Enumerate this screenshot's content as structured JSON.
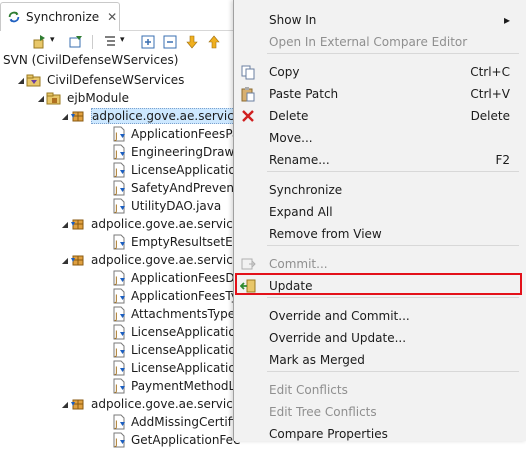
{
  "view": {
    "tab_title": "Synchronize",
    "tab_close": "✕",
    "header": "SVN (CivilDefenseWServices)",
    "tree": [
      {
        "label": "CivilDefenseWServices",
        "indent": 1,
        "twisty": "◢",
        "icon": "project-icon"
      },
      {
        "label": "ejbModule",
        "indent": 2,
        "twisty": "◢",
        "icon": "source-folder-icon"
      },
      {
        "label": "adpolice.gove.ae.servic",
        "indent": 3,
        "twisty": "◢",
        "icon": "package-icon",
        "selected": true
      },
      {
        "label": "ApplicationFeesPa",
        "indent": 4,
        "icon": "java-file-icon"
      },
      {
        "label": "EngineeringDrawi",
        "indent": 4,
        "icon": "java-file-icon"
      },
      {
        "label": "LicenseApplicatio",
        "indent": 4,
        "icon": "java-file-icon"
      },
      {
        "label": "SafetyAndPrevent",
        "indent": 4,
        "icon": "java-file-icon"
      },
      {
        "label": "UtilityDAO.java",
        "indent": 4,
        "icon": "java-file-icon"
      },
      {
        "label": "adpolice.gove.ae.servic",
        "indent": 3,
        "twisty": "◢",
        "icon": "package-icon"
      },
      {
        "label": "EmptyResultsetExc",
        "indent": 4,
        "icon": "java-file-icon"
      },
      {
        "label": "adpolice.gove.ae.servic",
        "indent": 3,
        "twisty": "◢",
        "icon": "package-icon"
      },
      {
        "label": "ApplicationFeesDa",
        "indent": 4,
        "icon": "java-file-icon"
      },
      {
        "label": "ApplicationFeesTy",
        "indent": 4,
        "icon": "java-file-icon"
      },
      {
        "label": "AttachmentsType",
        "indent": 4,
        "icon": "java-file-icon"
      },
      {
        "label": "LicenseApplicatio",
        "indent": 4,
        "icon": "java-file-icon"
      },
      {
        "label": "LicenseApplicatio",
        "indent": 4,
        "icon": "java-file-icon"
      },
      {
        "label": "LicenseApplicatio",
        "indent": 4,
        "icon": "java-file-icon"
      },
      {
        "label": "PaymentMethodL",
        "indent": 4,
        "icon": "java-file-icon"
      },
      {
        "label": "adpolice.gove.ae.servic",
        "indent": 3,
        "twisty": "◢",
        "icon": "package-icon"
      },
      {
        "label": "AddMissingCertifi",
        "indent": 4,
        "icon": "java-file-icon"
      },
      {
        "label": "GetApplicationFee",
        "indent": 4,
        "icon": "java-file-icon"
      }
    ]
  },
  "menu": {
    "items": [
      {
        "label": "Show In",
        "shortcut": "▸",
        "enabled": true
      },
      {
        "label": "Open In External Compare Editor",
        "shortcut": "",
        "enabled": false
      },
      {
        "label": "Copy",
        "shortcut": "Ctrl+C",
        "enabled": true,
        "icon": "copy-icon"
      },
      {
        "label": "Paste Patch",
        "shortcut": "Ctrl+V",
        "enabled": true,
        "icon": "paste-icon"
      },
      {
        "label": "Delete",
        "shortcut": "Delete",
        "enabled": true,
        "icon": "delete-icon"
      },
      {
        "label": "Move...",
        "shortcut": "",
        "enabled": true
      },
      {
        "label": "Rename...",
        "shortcut": "F2",
        "enabled": true
      },
      {
        "label": "Synchronize",
        "shortcut": "",
        "enabled": true
      },
      {
        "label": "Expand All",
        "shortcut": "",
        "enabled": true
      },
      {
        "label": "Remove from View",
        "shortcut": "",
        "enabled": true
      },
      {
        "label": "Commit...",
        "shortcut": "",
        "enabled": false,
        "icon": "commit-icon"
      },
      {
        "label": "Update",
        "shortcut": "",
        "enabled": true,
        "icon": "update-icon",
        "highlighted": true
      },
      {
        "label": "Override and Commit...",
        "shortcut": "",
        "enabled": true
      },
      {
        "label": "Override and Update...",
        "shortcut": "",
        "enabled": true
      },
      {
        "label": "Mark as Merged",
        "shortcut": "",
        "enabled": true
      },
      {
        "label": "Edit Conflicts",
        "shortcut": "",
        "enabled": false
      },
      {
        "label": "Edit Tree Conflicts",
        "shortcut": "",
        "enabled": false
      },
      {
        "label": "Compare Properties",
        "shortcut": "",
        "enabled": true
      }
    ]
  },
  "colors": {
    "highlight_border": "#e3111a",
    "selection": "#cde8ff",
    "menu_bg": "#f2f2f2",
    "disabled_text": "#8f8f8f"
  }
}
